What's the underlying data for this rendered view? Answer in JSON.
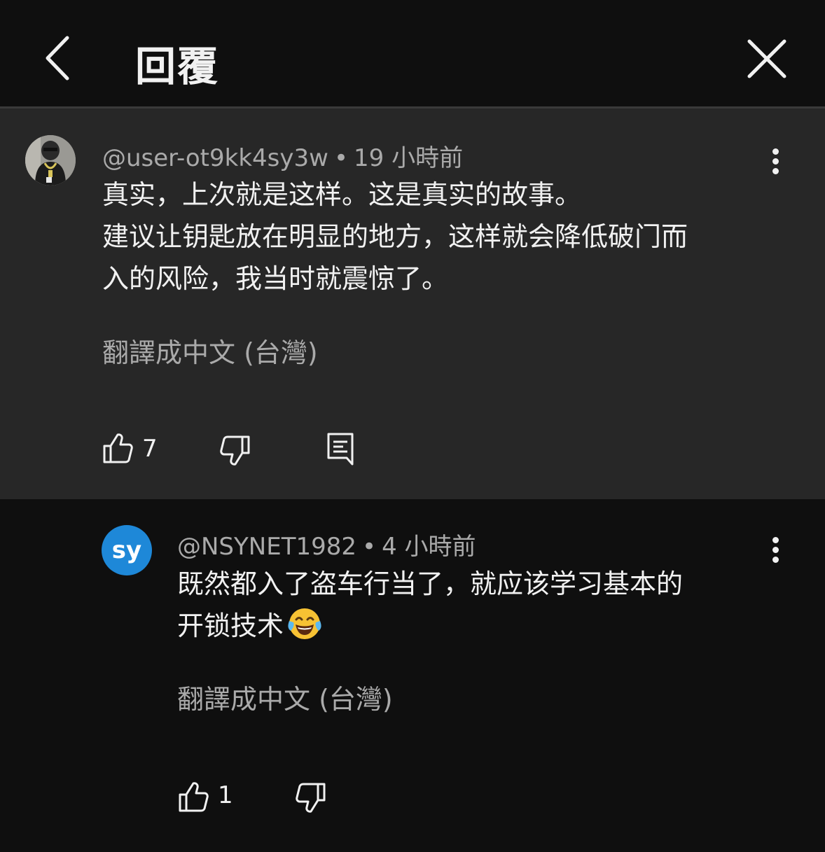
{
  "header": {
    "title": "回覆",
    "back_icon": "chevron-left-icon",
    "close_icon": "close-icon"
  },
  "comments": [
    {
      "author": "@user-ot9kk4sy3w",
      "separator": "•",
      "time": "19 小時前",
      "body_lines": [
        "真实，上次就是这样。这是真实的故事。",
        "建议让钥匙放在明显的地方，这样就会降低破门而",
        "入的风险，我当时就震惊了。"
      ],
      "translate": "翻譯成中文 (台灣)",
      "likes": "7",
      "icons": [
        "thumbs-up-icon",
        "thumbs-down-icon",
        "comment-icon",
        "more-vert-icon"
      ]
    },
    {
      "author": "@NSYNET1982",
      "avatar_initials": "sy",
      "avatar_color": "#1e88d8",
      "separator": "•",
      "time": "4 小時前",
      "body_lines": [
        "既然都入了盗车行当了，就应该学习基本的",
        "开锁技术"
      ],
      "emoji": "face-with-tears-of-joy-icon",
      "translate": "翻譯成中文 (台灣)",
      "likes": "1",
      "icons": [
        "thumbs-up-icon",
        "thumbs-down-icon",
        "more-vert-icon"
      ]
    }
  ],
  "colors": {
    "background": "#0f0f0f",
    "highlighted_comment_bg": "#272727",
    "primary_text": "#f1f1f1",
    "secondary_text": "#aaaaaa"
  }
}
